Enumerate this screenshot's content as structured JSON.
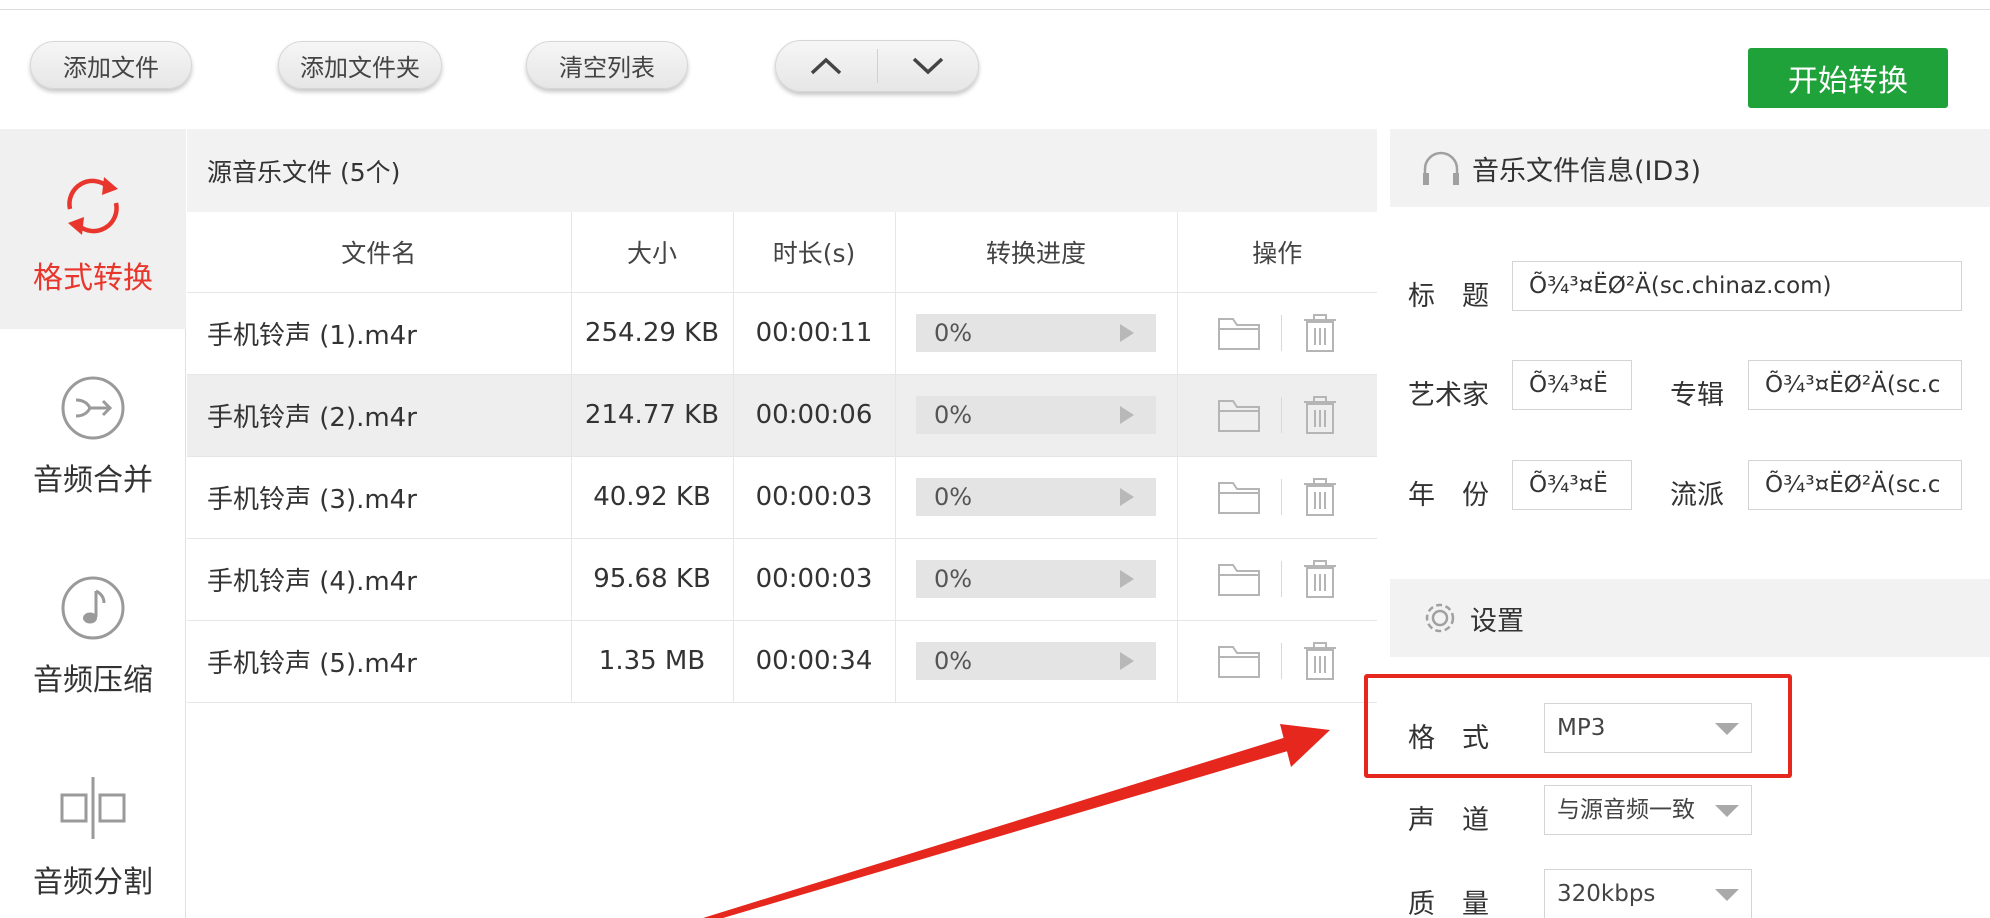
{
  "toolbar": {
    "add_file": "添加文件",
    "add_folder": "添加文件夹",
    "clear_list": "清空列表",
    "start_convert": "开始转换"
  },
  "sidebar": {
    "items": [
      {
        "label": "格式转换",
        "icon": "refresh-icon",
        "active": true
      },
      {
        "label": "音频合并",
        "icon": "merge-arrow-icon",
        "active": false
      },
      {
        "label": "音频压缩",
        "icon": "music-note-icon",
        "active": false
      },
      {
        "label": "音频分割",
        "icon": "split-icon",
        "active": false
      }
    ]
  },
  "file_list": {
    "title": "源音乐文件 (5个)",
    "columns": [
      "文件名",
      "大小",
      "时长(s)",
      "转换进度",
      "操作"
    ],
    "rows": [
      {
        "name": "手机铃声 (1).m4r",
        "size": "254.29 KB",
        "duration": "00:00:11",
        "progress": "0%"
      },
      {
        "name": "手机铃声 (2).m4r",
        "size": "214.77 KB",
        "duration": "00:00:06",
        "progress": "0%"
      },
      {
        "name": "手机铃声 (3).m4r",
        "size": "40.92 KB",
        "duration": "00:00:03",
        "progress": "0%"
      },
      {
        "name": "手机铃声 (4).m4r",
        "size": "95.68 KB",
        "duration": "00:00:03",
        "progress": "0%"
      },
      {
        "name": "手机铃声 (5).m4r",
        "size": "1.35 MB",
        "duration": "00:00:34",
        "progress": "0%"
      }
    ]
  },
  "id3": {
    "title": "音乐文件信息(ID3)",
    "labels": {
      "title": "标　题",
      "artist": "艺术家",
      "album": "专辑",
      "year": "年　份",
      "genre": "流派"
    },
    "values": {
      "title": "Õ¾³¤ËØ²Ä(sc.chinaz.com)",
      "artist": "Õ¾³¤Ë",
      "album": "Õ¾³¤ËØ²Ä(sc.c",
      "year": "Õ¾³¤Ë",
      "genre": "Õ¾³¤ËØ²Ä(sc.c"
    }
  },
  "settings": {
    "title": "设置",
    "format_label": "格　式",
    "format_value": "MP3",
    "channel_label": "声　道",
    "channel_value": "与源音频一致",
    "quality_label": "质　量",
    "quality_value": "320kbps"
  },
  "colors": {
    "accent_red": "#e8362d",
    "start_green": "#1fa23a",
    "annotation_red": "#e5271e"
  }
}
